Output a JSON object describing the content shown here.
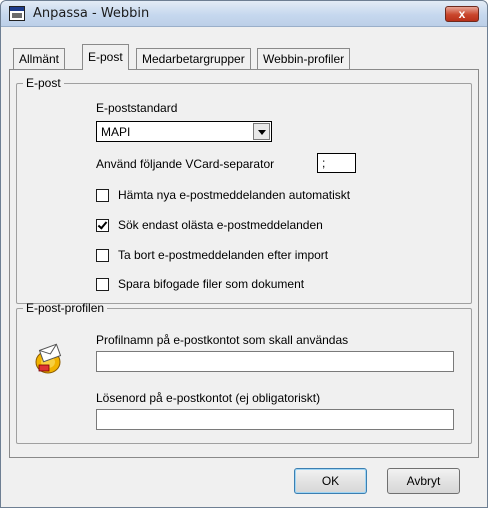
{
  "window": {
    "title": "Anpassa - Webbin",
    "close_glyph": "x"
  },
  "tabs": [
    {
      "label": "Allmänt",
      "active": false
    },
    {
      "label": "E-post",
      "active": true
    },
    {
      "label": "Medarbetargrupper",
      "active": false
    },
    {
      "label": "Webbin-profiler",
      "active": false
    }
  ],
  "email_group": {
    "legend": "E-post",
    "standard_label": "E-poststandard",
    "standard_value": "MAPI",
    "vcard_label": "Använd följande VCard-separator",
    "vcard_value": ";",
    "checkboxes": [
      {
        "label": "Hämta nya e-postmeddelanden automatiskt",
        "checked": false
      },
      {
        "label": "Sök endast olästa e-postmeddelanden",
        "checked": true
      },
      {
        "label": "Ta bort e-postmeddelanden efter import",
        "checked": false
      },
      {
        "label": "Spara bifogade filer som dokument",
        "checked": false
      }
    ]
  },
  "profile_group": {
    "legend": "E-post-profilen",
    "profile_label": "Profilnamn på e-postkontot som skall användas",
    "profile_value": "",
    "password_label": "Lösenord på e-postkontot (ej obligatoriskt)",
    "password_value": "",
    "icon": "email-profile-icon"
  },
  "buttons": {
    "ok_label": "OK",
    "cancel_label": "Avbryt"
  },
  "colors": {
    "titlebar": "#c6d8ee",
    "close": "#c9462c",
    "dialog_bg": "#f0f0f0"
  }
}
